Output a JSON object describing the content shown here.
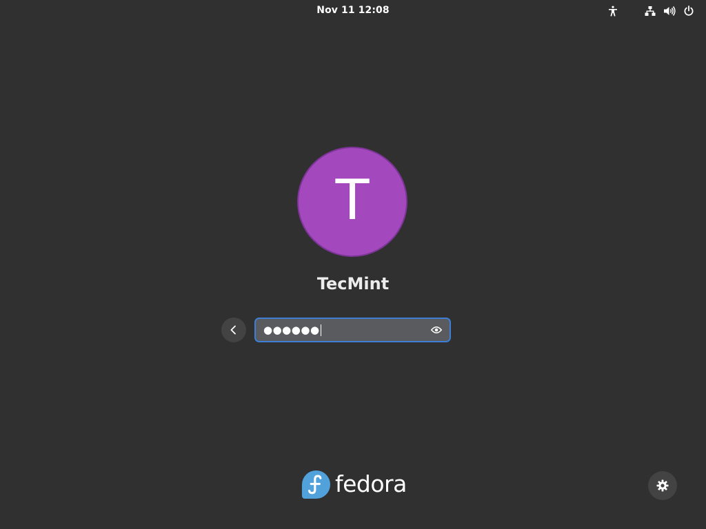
{
  "top_bar": {
    "clock": "Nov 11  12:08",
    "icons": [
      "accessibility-icon",
      "network-icon",
      "volume-icon",
      "power-icon"
    ]
  },
  "user": {
    "avatar_initial": "T",
    "avatar_color": "#a349bd",
    "name": "TecMint"
  },
  "login": {
    "password_masked": "●●●●●●",
    "field_border_color": "#3d7ed6",
    "back_icon": "chevron-left-icon",
    "reveal_icon": "eye-icon"
  },
  "branding": {
    "logo_text": "fedora",
    "logo_color": "#51a2da"
  },
  "footer": {
    "settings_icon": "gear-icon"
  }
}
